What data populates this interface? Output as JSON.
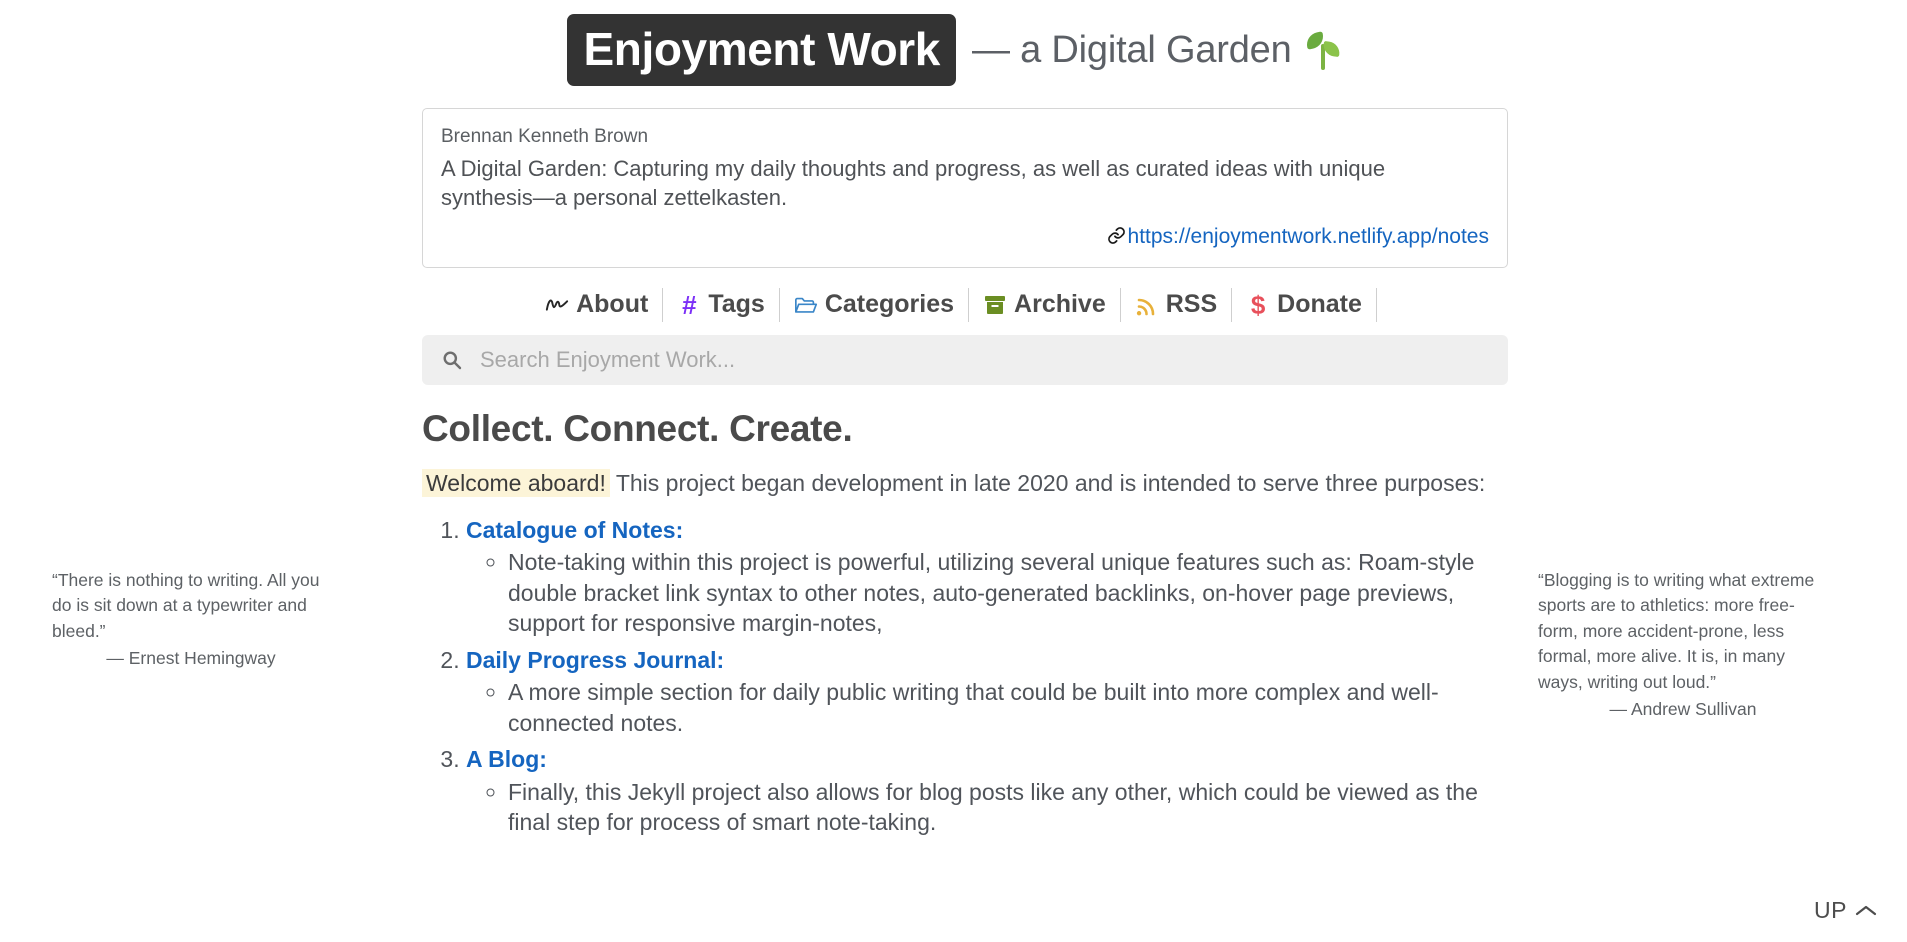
{
  "header": {
    "title_badge": "Enjoyment Work",
    "title_rest": "— a Digital Garden",
    "title_emoji_name": "seedling-icon"
  },
  "description_card": {
    "author": "Brennan Kenneth Brown",
    "text": "A Digital Garden: Capturing my daily thoughts and progress, as well as curated ideas with unique synthesis—a personal zettelkasten.",
    "link_text": "https://enjoymentwork.netlify.app/notes",
    "link_icon": "link-icon",
    "link_color": "#1565c0"
  },
  "nav": {
    "items": [
      {
        "label": "About",
        "icon": "signature-icon",
        "icon_color": "#333333"
      },
      {
        "label": "Tags",
        "icon": "hash-icon",
        "icon_color": "#7b2ff7"
      },
      {
        "label": "Categories",
        "icon": "folder-open-icon",
        "icon_color": "#3a86c8"
      },
      {
        "label": "Archive",
        "icon": "archive-box-icon",
        "icon_color": "#6b8e23"
      },
      {
        "label": "RSS",
        "icon": "rss-icon",
        "icon_color": "#e8b13a"
      },
      {
        "label": "Donate",
        "icon": "dollar-icon",
        "icon_color": "#e8505b"
      }
    ]
  },
  "search": {
    "placeholder": "Search Enjoyment Work...",
    "value": "",
    "icon": "search-icon"
  },
  "main": {
    "heading": "Collect. Connect. Create.",
    "intro_highlight": "Welcome aboard!",
    "intro_text": "This project began development in late 2020 and is intended to serve three purposes:",
    "list": [
      {
        "link": "Catalogue of Notes:",
        "detail": "Note-taking within this project is powerful, utilizing several unique features such as: Roam-style double bracket link syntax to other notes, auto-generated backlinks, on-hover page previews, support for responsive margin-notes,"
      },
      {
        "link": "Daily Progress Journal:",
        "detail": "A more simple section for daily public writing that could be built into more complex and well-connected notes."
      },
      {
        "link": "A Blog:",
        "detail": "Finally, this Jekyll project also allows for blog posts like any other, which could be viewed as the final step for process of smart note-taking."
      }
    ]
  },
  "margin_notes": {
    "left": {
      "quote": "“There is nothing to writing. All you do is sit down at a typewriter and bleed.”",
      "attribution": "— Ernest Hemingway"
    },
    "right": {
      "quote": "“Blogging is to writing what extreme sports are to athletics: more free-form, more accident-prone, less formal, more alive. It is, in many ways, writing out loud.”",
      "attribution": "— Andrew Sullivan"
    }
  },
  "up_link": {
    "label": "UP",
    "icon": "chevron-up-icon"
  }
}
